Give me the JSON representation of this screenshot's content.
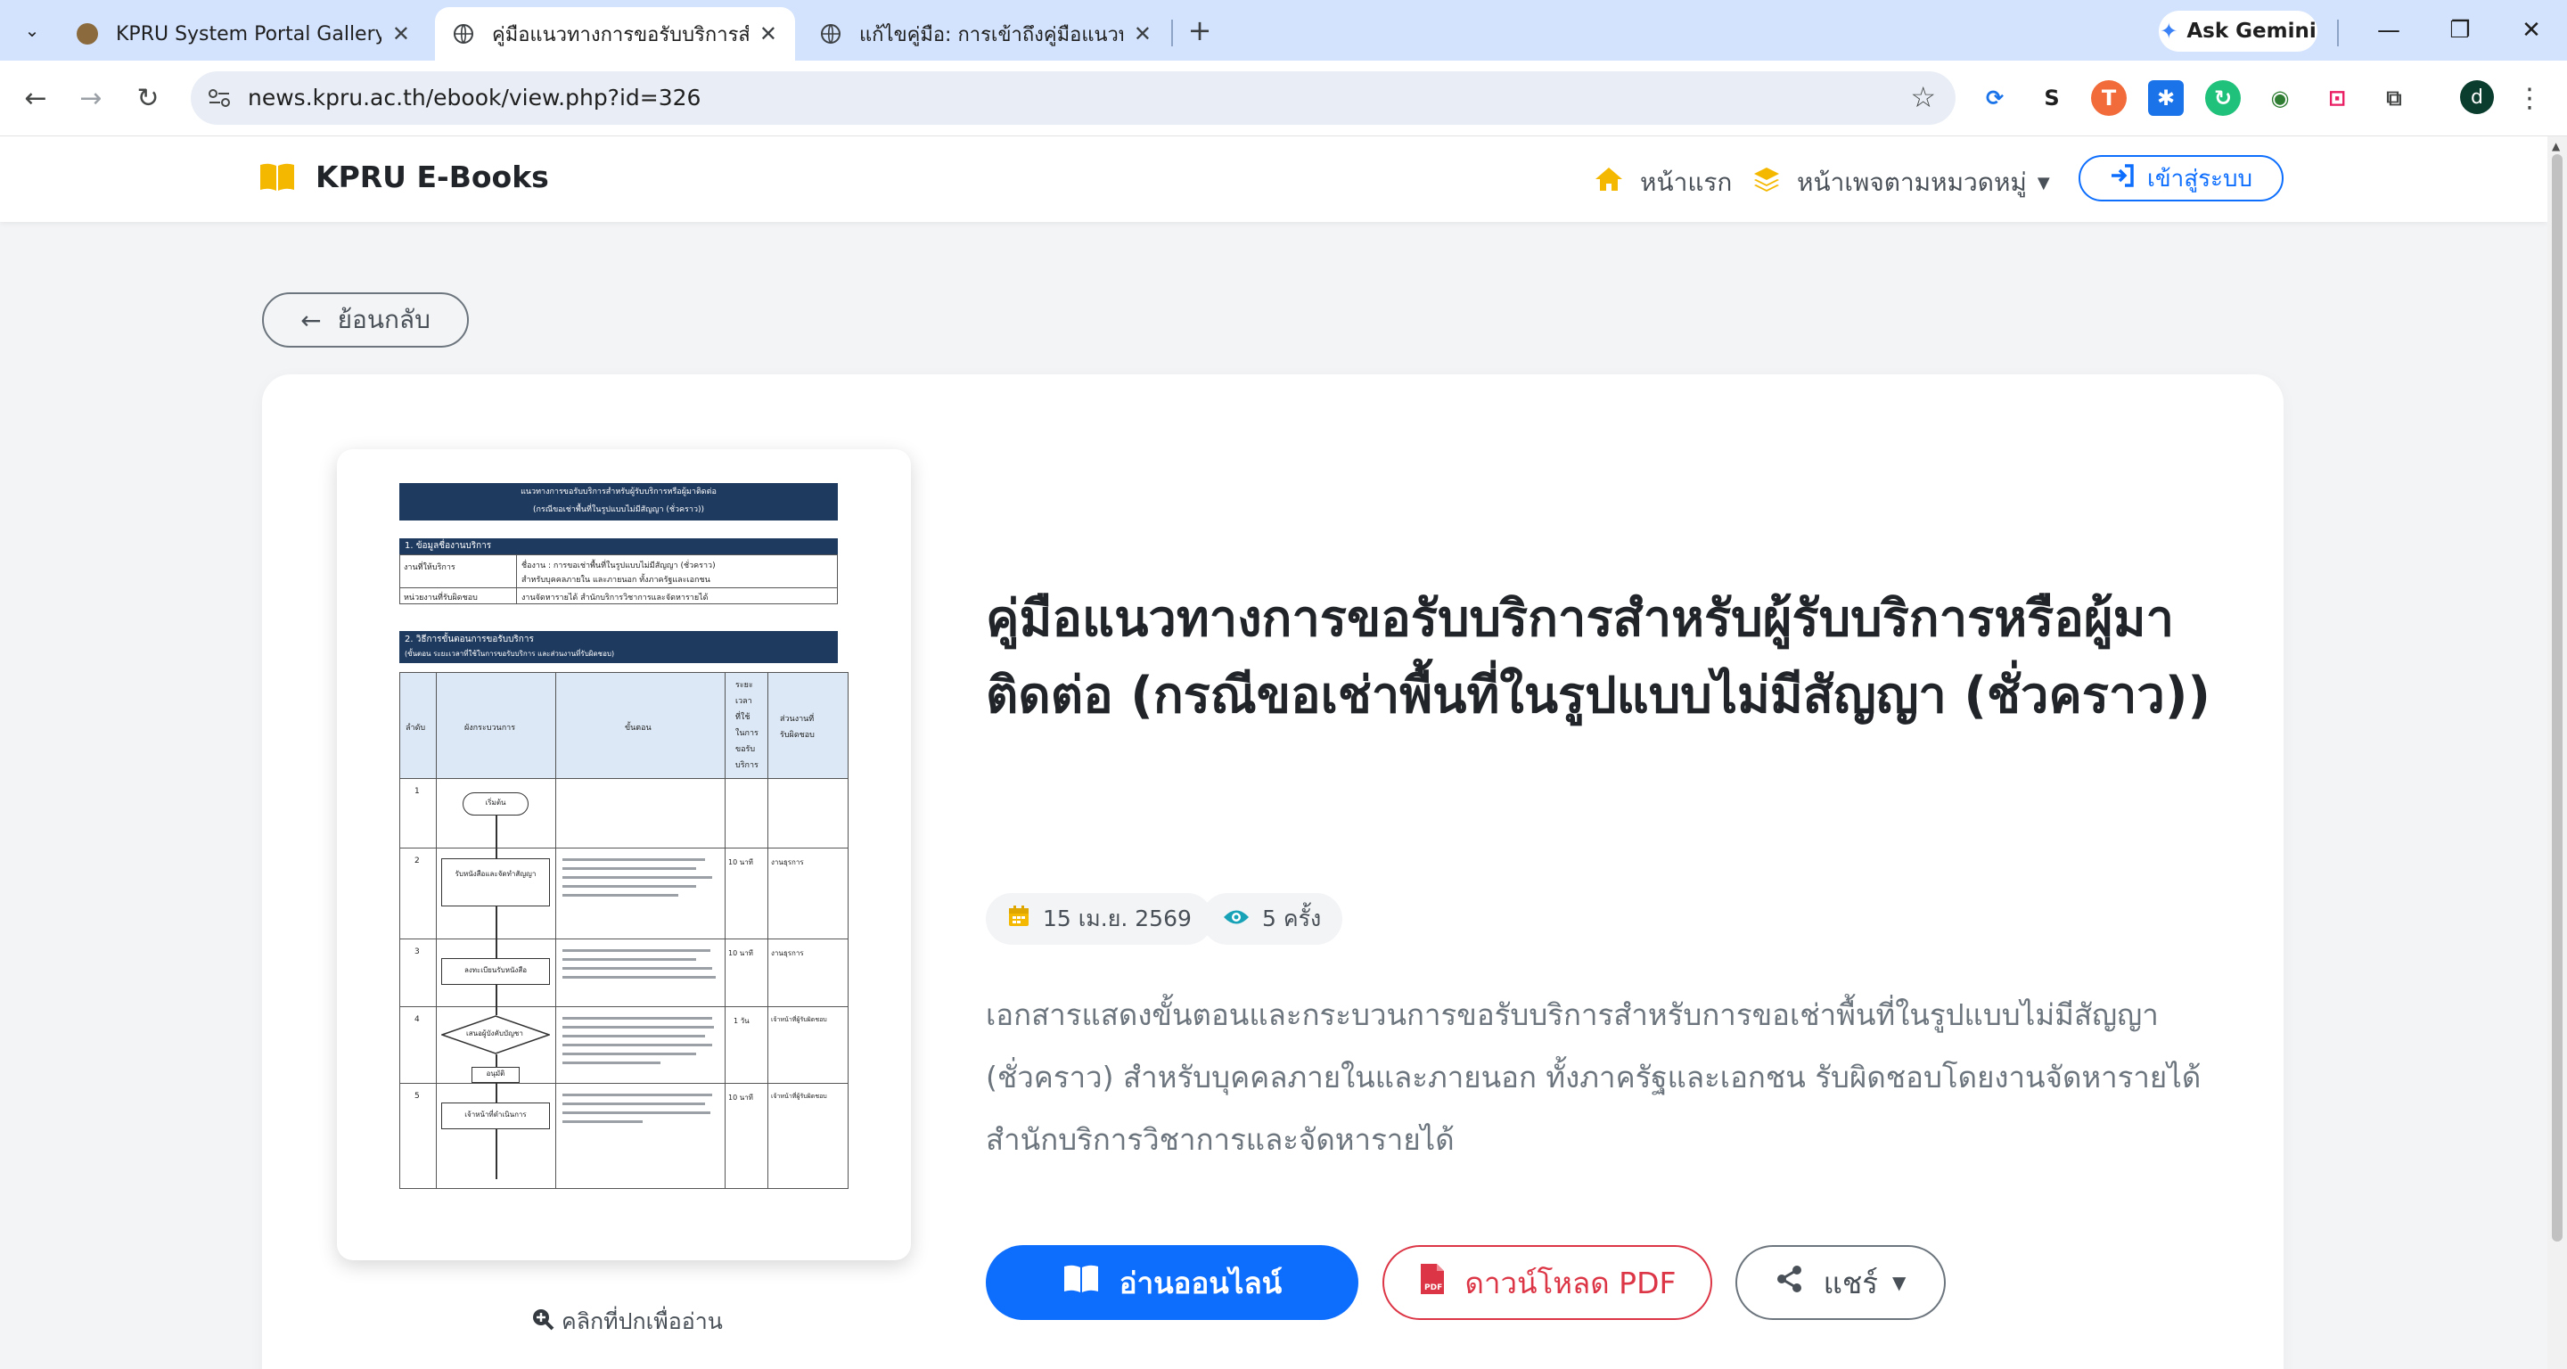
{
  "browser": {
    "tabs": [
      {
        "title": "KPRU System Portal Gallery",
        "active": false
      },
      {
        "title": "คู่มือแนวทางการขอรับบริการสำหรับผู้",
        "active": true
      },
      {
        "title": "แก้ไขคู่มือ: การเข้าถึงคู่มือแนวทางกา",
        "active": false
      }
    ],
    "new_tab_icon": "plus-icon",
    "gemini_label": "Ask Gemini",
    "url": "news.kpru.ac.th/ebook/view.php?id=326",
    "profile_initial": "d"
  },
  "navbar": {
    "brand": "KPRU E-Books",
    "home": "หน้าแรก",
    "categories": "หน้าเพจตามหมวดหมู่",
    "login": "เข้าสู่ระบบ"
  },
  "back_label": "ย้อนกลับ",
  "book": {
    "title": "คู่มือแนวทางการขอรับบริการสำหรับผู้รับบริการหรือผู้มาติดต่อ (กรณีขอเช่าพื้นที่ในรูปแบบไม่มีสัญญา (ชั่วคราว))",
    "date": "15 เม.ย. 2569",
    "views": "5 ครั้ง",
    "description": "เอกสารแสดงขั้นตอนและกระบวนการขอรับบริการสำหรับการขอเช่าพื้นที่ในรูปแบบไม่มีสัญญา (ชั่วคราว) สำหรับบุคคลภายในและภายนอก ทั้งภาครัฐและเอกชน รับผิดชอบโดยงานจัดหารายได้ สำนักบริการวิชาการและจัดหารายได้",
    "cover_hint": "คลิกที่ปกเพื่ออ่าน",
    "read_btn": "อ่านออนไลน์",
    "pdf_btn": "ดาวน์โหลด PDF",
    "share_btn": "แชร์"
  },
  "cover_doc": {
    "header_line1": "แนวทางการขอรับบริการสำหรับผู้รับบริการหรือผู้มาติดต่อ",
    "header_line2": "(กรณีขอเช่าพื้นที่ในรูปแบบไม่มีสัญญา (ชั่วคราว))",
    "section1": "1. ข้อมูลชื่องานบริการ",
    "row1_label": "งานที่ให้บริการ",
    "row1_value_a": "ชื่องาน : การขอเช่าพื้นที่ในรูปแบบไม่มีสัญญา (ชั่วคราว)",
    "row1_value_b": "สำหรับบุคคลภายใน และภายนอก ทั้งภาครัฐและเอกชน",
    "row2_label": "หน่วยงานที่รับผิดชอบ",
    "row2_value": "งานจัดหารายได้ สำนักบริการวิชาการและจัดหารายได้",
    "section2": "2. วิธีการขั้นตอนการขอรับบริการ",
    "section2_sub": "(ขั้นตอน ระยะเวลาที่ใช้ในการขอรับบริการ และส่วนงานที่รับผิดชอบ)",
    "col_no": "ลำดับ",
    "col_flow": "ผังกระบวนการ",
    "col_step": "ขั้นตอน",
    "col_time_1": "ระยะ",
    "col_time_2": "เวลา",
    "col_time_3": "ที่ใช้",
    "col_time_4": "ในการ",
    "col_time_5": "ขอรับ",
    "col_time_6": "บริการ",
    "col_dept_1": "ส่วนงานที่",
    "col_dept_2": "รับผิดชอบ",
    "rows": [
      "1",
      "2",
      "3",
      "4",
      "5"
    ],
    "flow_start": "เริ่มต้น",
    "flow_step2": "รับหนังสือและจัดทำสัญญา",
    "flow_step3": "ลงทะเบียนรับหนังสือ",
    "flow_decision": "เสนอผู้บังคับบัญชา",
    "flow_approve": "อนุมัติ",
    "flow_step5": "เจ้าหน้าที่ดำเนินการ",
    "time_2": "10 นาที",
    "time_3": "10 นาที",
    "time_4": "1 วัน",
    "time_5": "10 นาที",
    "dept_2": "งานธุรการ",
    "dept_3": "งานธุรการ",
    "dept_4": "เจ้าหน้าที่ผู้รับผิดชอบ",
    "dept_5": "เจ้าหน้าที่ผู้รับผิดชอบ"
  },
  "colors": {
    "primary": "#0d6efd",
    "danger": "#dc3545",
    "accent": "#f5b800",
    "tabstrip": "#d3e3fd"
  }
}
